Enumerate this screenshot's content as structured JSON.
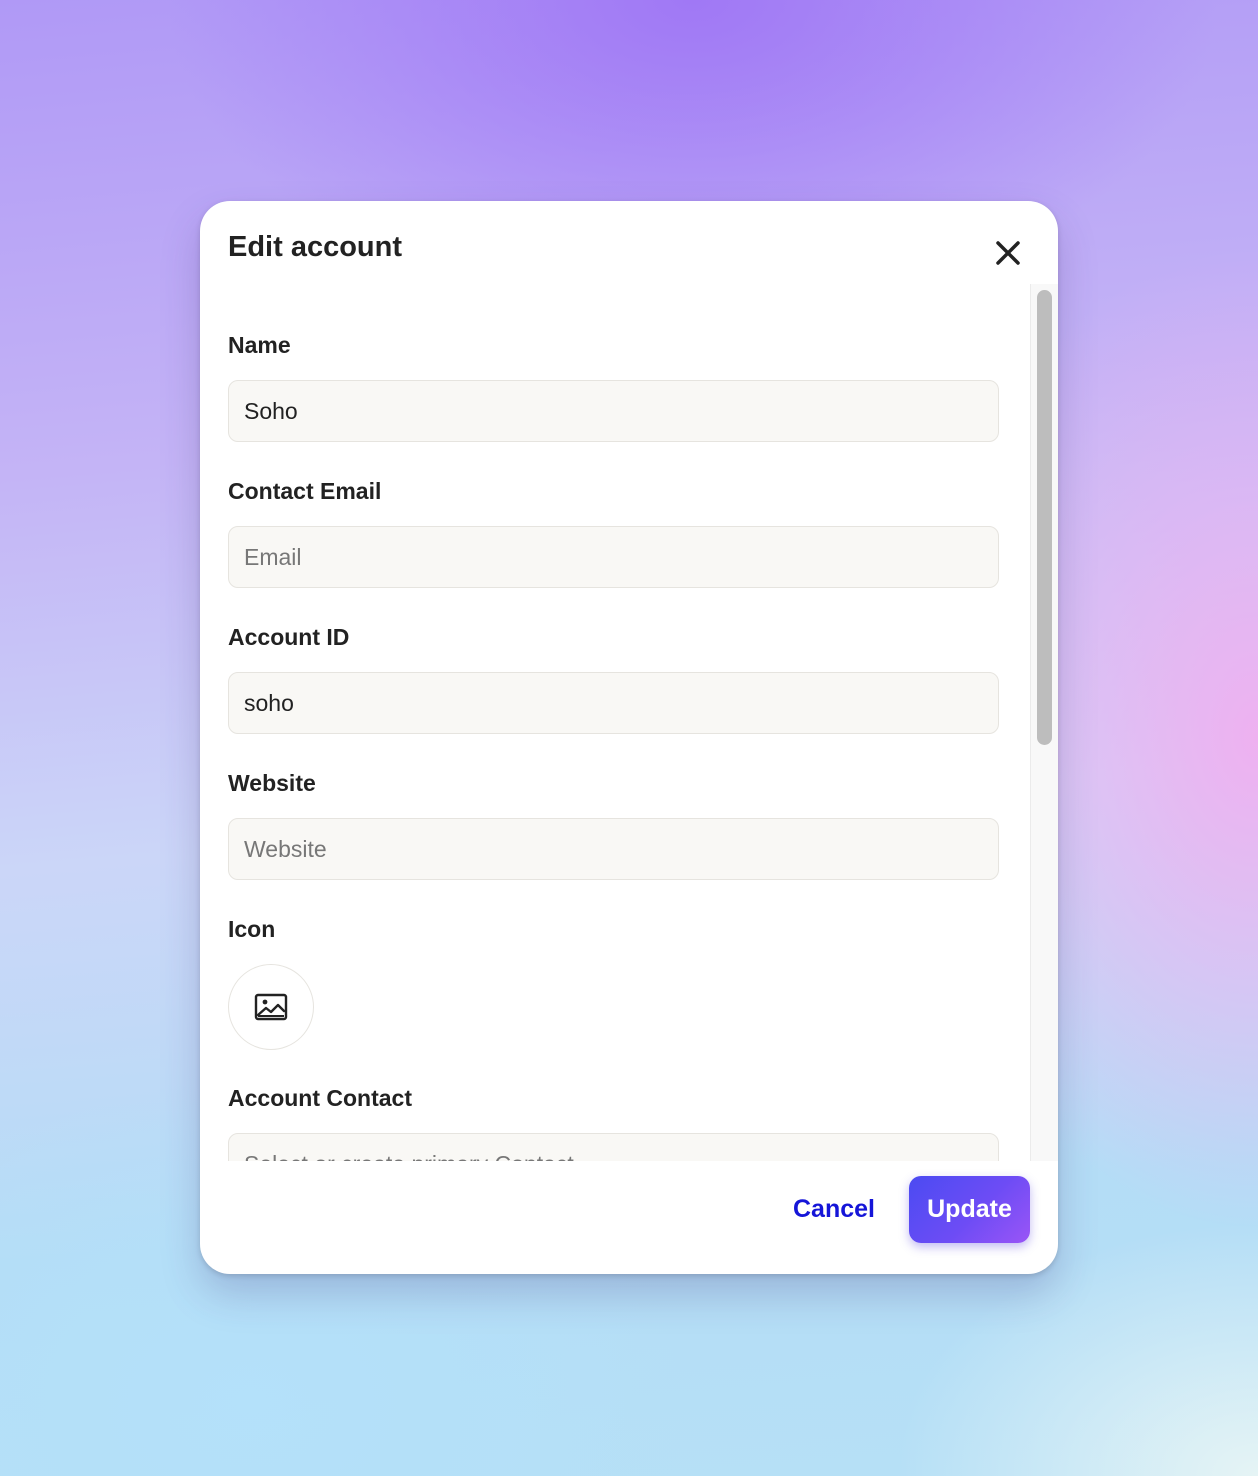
{
  "modal": {
    "title": "Edit account",
    "close_icon": "close-icon"
  },
  "form": {
    "name": {
      "label": "Name",
      "value": "Soho",
      "placeholder": ""
    },
    "contact_email": {
      "label": "Contact Email",
      "value": "",
      "placeholder": "Email"
    },
    "account_id": {
      "label": "Account ID",
      "value": "soho",
      "placeholder": ""
    },
    "website": {
      "label": "Website",
      "value": "",
      "placeholder": "Website"
    },
    "icon": {
      "label": "Icon",
      "icon": "image-icon"
    },
    "account_contact": {
      "label": "Account Contact",
      "value": "",
      "placeholder": "Select or create primary Contact"
    }
  },
  "footer": {
    "cancel_label": "Cancel",
    "update_label": "Update"
  },
  "colors": {
    "accent": "#1515d8",
    "update_gradient_start": "#4b4bf2",
    "update_gradient_end": "#9a55f6"
  }
}
